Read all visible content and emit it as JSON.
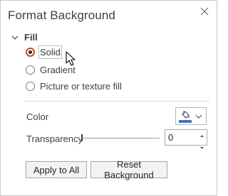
{
  "pane": {
    "title": "Format Background",
    "close_icon": "close-icon"
  },
  "fill_section": {
    "label": "Fill",
    "expanded": true,
    "options": [
      {
        "label": "Solid",
        "selected": true
      },
      {
        "label": "Gradient",
        "selected": false
      },
      {
        "label": "Picture or texture fill",
        "selected": false
      }
    ]
  },
  "color": {
    "label": "Color",
    "swatch_color": "#4472c4",
    "icon": "paint-bucket-icon"
  },
  "transparency": {
    "label": "Transparency",
    "value": "0",
    "level": 0
  },
  "buttons": {
    "apply_all": "Apply to All",
    "reset": "Reset Background"
  },
  "colors": {
    "accent_radio": "#d24726"
  }
}
